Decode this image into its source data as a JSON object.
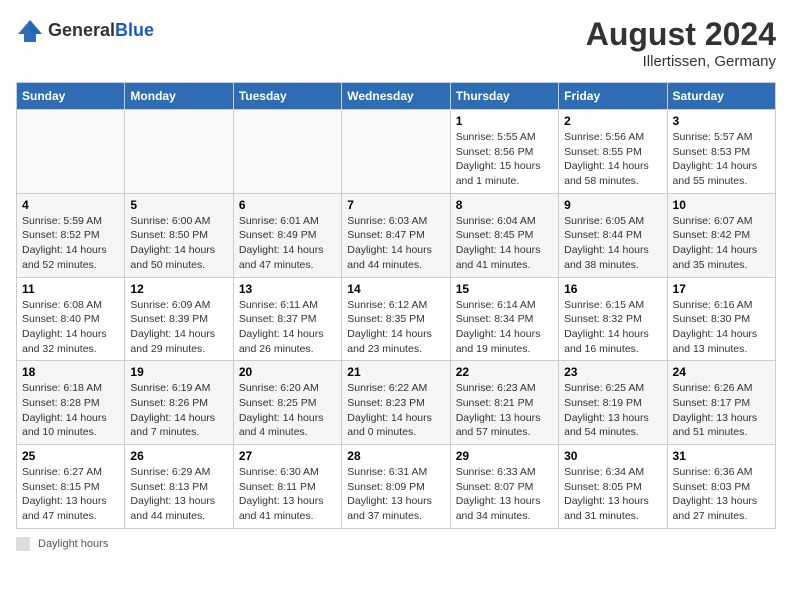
{
  "header": {
    "logo_general": "General",
    "logo_blue": "Blue",
    "month_year": "August 2024",
    "location": "Illertissen, Germany"
  },
  "days_of_week": [
    "Sunday",
    "Monday",
    "Tuesday",
    "Wednesday",
    "Thursday",
    "Friday",
    "Saturday"
  ],
  "footer": {
    "legend_label": "Daylight hours"
  },
  "weeks": [
    [
      {
        "day": "",
        "sunrise": "",
        "sunset": "",
        "daylight": "",
        "empty": true
      },
      {
        "day": "",
        "sunrise": "",
        "sunset": "",
        "daylight": "",
        "empty": true
      },
      {
        "day": "",
        "sunrise": "",
        "sunset": "",
        "daylight": "",
        "empty": true
      },
      {
        "day": "",
        "sunrise": "",
        "sunset": "",
        "daylight": "",
        "empty": true
      },
      {
        "day": "1",
        "sunrise": "Sunrise: 5:55 AM",
        "sunset": "Sunset: 8:56 PM",
        "daylight": "Daylight: 15 hours and 1 minute.",
        "empty": false
      },
      {
        "day": "2",
        "sunrise": "Sunrise: 5:56 AM",
        "sunset": "Sunset: 8:55 PM",
        "daylight": "Daylight: 14 hours and 58 minutes.",
        "empty": false
      },
      {
        "day": "3",
        "sunrise": "Sunrise: 5:57 AM",
        "sunset": "Sunset: 8:53 PM",
        "daylight": "Daylight: 14 hours and 55 minutes.",
        "empty": false
      }
    ],
    [
      {
        "day": "4",
        "sunrise": "Sunrise: 5:59 AM",
        "sunset": "Sunset: 8:52 PM",
        "daylight": "Daylight: 14 hours and 52 minutes.",
        "empty": false
      },
      {
        "day": "5",
        "sunrise": "Sunrise: 6:00 AM",
        "sunset": "Sunset: 8:50 PM",
        "daylight": "Daylight: 14 hours and 50 minutes.",
        "empty": false
      },
      {
        "day": "6",
        "sunrise": "Sunrise: 6:01 AM",
        "sunset": "Sunset: 8:49 PM",
        "daylight": "Daylight: 14 hours and 47 minutes.",
        "empty": false
      },
      {
        "day": "7",
        "sunrise": "Sunrise: 6:03 AM",
        "sunset": "Sunset: 8:47 PM",
        "daylight": "Daylight: 14 hours and 44 minutes.",
        "empty": false
      },
      {
        "day": "8",
        "sunrise": "Sunrise: 6:04 AM",
        "sunset": "Sunset: 8:45 PM",
        "daylight": "Daylight: 14 hours and 41 minutes.",
        "empty": false
      },
      {
        "day": "9",
        "sunrise": "Sunrise: 6:05 AM",
        "sunset": "Sunset: 8:44 PM",
        "daylight": "Daylight: 14 hours and 38 minutes.",
        "empty": false
      },
      {
        "day": "10",
        "sunrise": "Sunrise: 6:07 AM",
        "sunset": "Sunset: 8:42 PM",
        "daylight": "Daylight: 14 hours and 35 minutes.",
        "empty": false
      }
    ],
    [
      {
        "day": "11",
        "sunrise": "Sunrise: 6:08 AM",
        "sunset": "Sunset: 8:40 PM",
        "daylight": "Daylight: 14 hours and 32 minutes.",
        "empty": false
      },
      {
        "day": "12",
        "sunrise": "Sunrise: 6:09 AM",
        "sunset": "Sunset: 8:39 PM",
        "daylight": "Daylight: 14 hours and 29 minutes.",
        "empty": false
      },
      {
        "day": "13",
        "sunrise": "Sunrise: 6:11 AM",
        "sunset": "Sunset: 8:37 PM",
        "daylight": "Daylight: 14 hours and 26 minutes.",
        "empty": false
      },
      {
        "day": "14",
        "sunrise": "Sunrise: 6:12 AM",
        "sunset": "Sunset: 8:35 PM",
        "daylight": "Daylight: 14 hours and 23 minutes.",
        "empty": false
      },
      {
        "day": "15",
        "sunrise": "Sunrise: 6:14 AM",
        "sunset": "Sunset: 8:34 PM",
        "daylight": "Daylight: 14 hours and 19 minutes.",
        "empty": false
      },
      {
        "day": "16",
        "sunrise": "Sunrise: 6:15 AM",
        "sunset": "Sunset: 8:32 PM",
        "daylight": "Daylight: 14 hours and 16 minutes.",
        "empty": false
      },
      {
        "day": "17",
        "sunrise": "Sunrise: 6:16 AM",
        "sunset": "Sunset: 8:30 PM",
        "daylight": "Daylight: 14 hours and 13 minutes.",
        "empty": false
      }
    ],
    [
      {
        "day": "18",
        "sunrise": "Sunrise: 6:18 AM",
        "sunset": "Sunset: 8:28 PM",
        "daylight": "Daylight: 14 hours and 10 minutes.",
        "empty": false
      },
      {
        "day": "19",
        "sunrise": "Sunrise: 6:19 AM",
        "sunset": "Sunset: 8:26 PM",
        "daylight": "Daylight: 14 hours and 7 minutes.",
        "empty": false
      },
      {
        "day": "20",
        "sunrise": "Sunrise: 6:20 AM",
        "sunset": "Sunset: 8:25 PM",
        "daylight": "Daylight: 14 hours and 4 minutes.",
        "empty": false
      },
      {
        "day": "21",
        "sunrise": "Sunrise: 6:22 AM",
        "sunset": "Sunset: 8:23 PM",
        "daylight": "Daylight: 14 hours and 0 minutes.",
        "empty": false
      },
      {
        "day": "22",
        "sunrise": "Sunrise: 6:23 AM",
        "sunset": "Sunset: 8:21 PM",
        "daylight": "Daylight: 13 hours and 57 minutes.",
        "empty": false
      },
      {
        "day": "23",
        "sunrise": "Sunrise: 6:25 AM",
        "sunset": "Sunset: 8:19 PM",
        "daylight": "Daylight: 13 hours and 54 minutes.",
        "empty": false
      },
      {
        "day": "24",
        "sunrise": "Sunrise: 6:26 AM",
        "sunset": "Sunset: 8:17 PM",
        "daylight": "Daylight: 13 hours and 51 minutes.",
        "empty": false
      }
    ],
    [
      {
        "day": "25",
        "sunrise": "Sunrise: 6:27 AM",
        "sunset": "Sunset: 8:15 PM",
        "daylight": "Daylight: 13 hours and 47 minutes.",
        "empty": false
      },
      {
        "day": "26",
        "sunrise": "Sunrise: 6:29 AM",
        "sunset": "Sunset: 8:13 PM",
        "daylight": "Daylight: 13 hours and 44 minutes.",
        "empty": false
      },
      {
        "day": "27",
        "sunrise": "Sunrise: 6:30 AM",
        "sunset": "Sunset: 8:11 PM",
        "daylight": "Daylight: 13 hours and 41 minutes.",
        "empty": false
      },
      {
        "day": "28",
        "sunrise": "Sunrise: 6:31 AM",
        "sunset": "Sunset: 8:09 PM",
        "daylight": "Daylight: 13 hours and 37 minutes.",
        "empty": false
      },
      {
        "day": "29",
        "sunrise": "Sunrise: 6:33 AM",
        "sunset": "Sunset: 8:07 PM",
        "daylight": "Daylight: 13 hours and 34 minutes.",
        "empty": false
      },
      {
        "day": "30",
        "sunrise": "Sunrise: 6:34 AM",
        "sunset": "Sunset: 8:05 PM",
        "daylight": "Daylight: 13 hours and 31 minutes.",
        "empty": false
      },
      {
        "day": "31",
        "sunrise": "Sunrise: 6:36 AM",
        "sunset": "Sunset: 8:03 PM",
        "daylight": "Daylight: 13 hours and 27 minutes.",
        "empty": false
      }
    ]
  ]
}
